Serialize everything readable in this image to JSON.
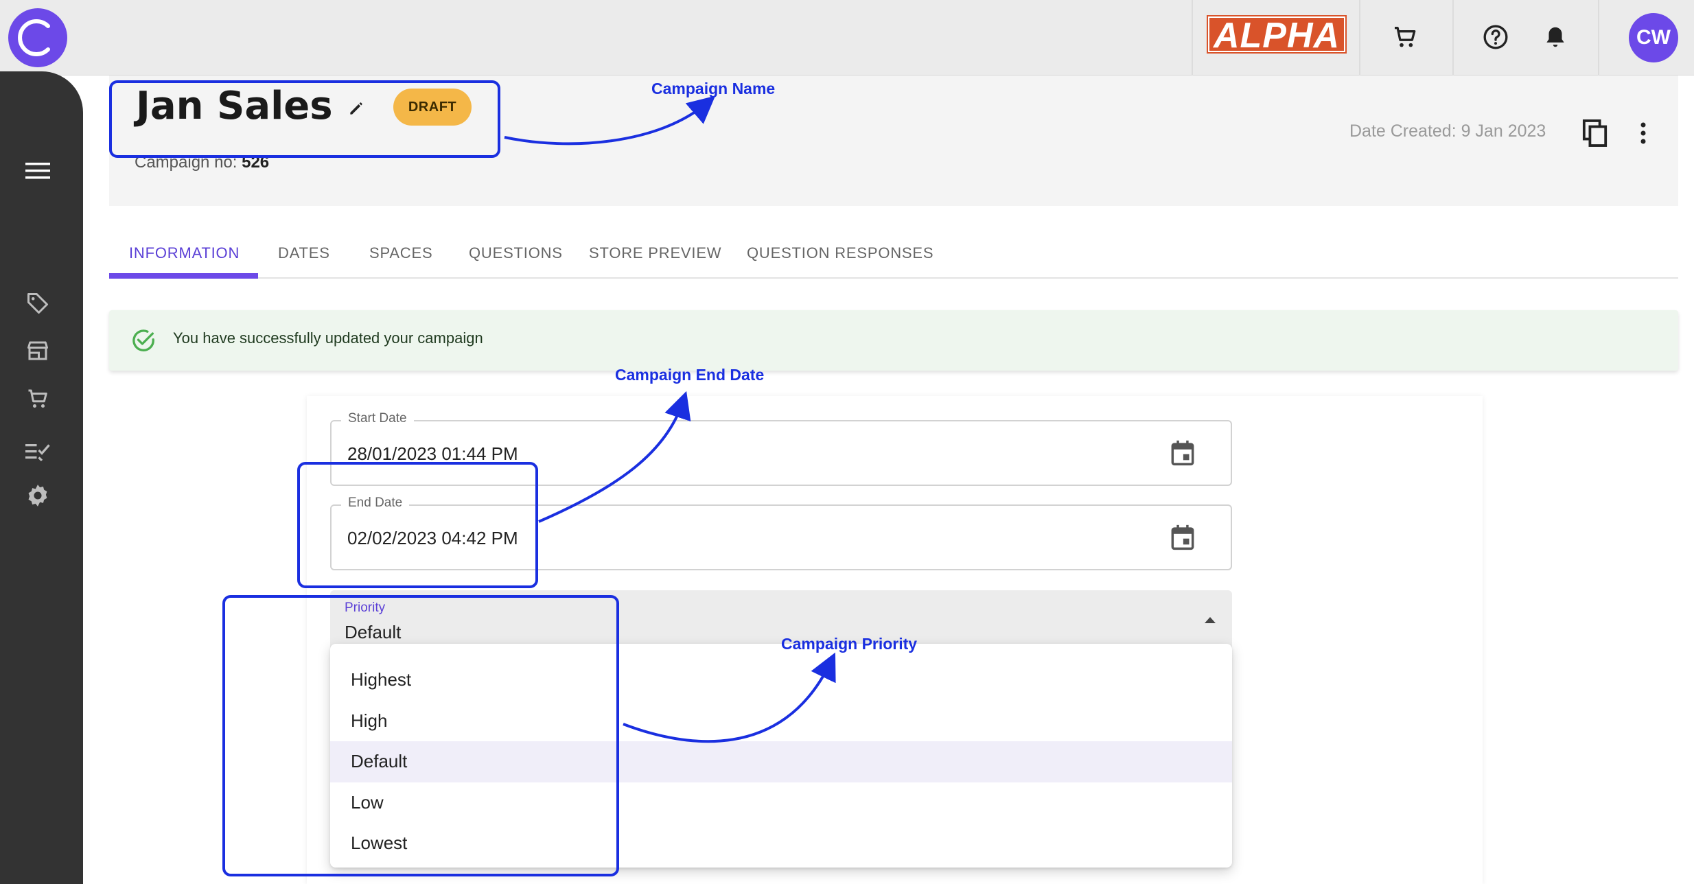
{
  "topbar": {
    "logo_icon": "c-logo-icon",
    "env_badge": "ALPHA",
    "icons": [
      "cart-icon",
      "help-icon",
      "bell-icon"
    ],
    "avatar_initials": "CW"
  },
  "sidebar": {
    "items": [
      "menu-icon",
      "tag-icon",
      "store-icon",
      "cart-icon",
      "checklist-icon",
      "gear-icon"
    ]
  },
  "header": {
    "title": "Jan Sales",
    "status": "DRAFT",
    "campaign_no_label": "Campaign no: ",
    "campaign_no": "526",
    "date_created": "Date Created: 9 Jan 2023"
  },
  "tabs": [
    {
      "label": "INFORMATION",
      "active": true
    },
    {
      "label": "DATES"
    },
    {
      "label": "SPACES"
    },
    {
      "label": "QUESTIONS"
    },
    {
      "label": "STORE PREVIEW"
    },
    {
      "label": "QUESTION RESPONSES"
    }
  ],
  "alert": {
    "message": "You have successfully updated your campaign",
    "color": "#4caf50"
  },
  "form": {
    "start_date": {
      "label": "Start Date",
      "value": "28/01/2023 01:44 PM"
    },
    "end_date": {
      "label": "End Date",
      "value": "02/02/2023 04:42 PM"
    },
    "priority": {
      "label": "Priority",
      "value": "Default",
      "options": [
        "Highest",
        "High",
        "Default",
        "Low",
        "Lowest"
      ],
      "selected_index": 2
    }
  },
  "annotations": {
    "campaign_name": "Campaign Name",
    "campaign_end_date": "Campaign End Date",
    "campaign_priority": "Campaign Priority",
    "color": "#1a2fe0"
  },
  "colors": {
    "brand": "#6c49e8",
    "sidebar": "#333333",
    "draft": "#f4b748",
    "alpha": "#d9532a"
  }
}
